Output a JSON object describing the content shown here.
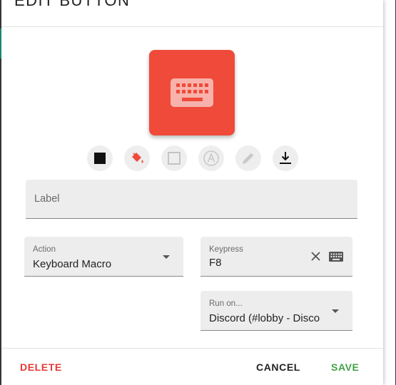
{
  "dialog": {
    "title": "EDIT BUTTON"
  },
  "preview": {
    "background_color": "#f04a3a",
    "icon": "keyboard-icon"
  },
  "toolbar": {
    "tools": [
      {
        "name": "color-swatch-icon",
        "state": "enabled"
      },
      {
        "name": "paint-bucket-icon",
        "state": "enabled"
      },
      {
        "name": "border-square-icon",
        "state": "disabled"
      },
      {
        "name": "text-a-icon",
        "state": "disabled"
      },
      {
        "name": "pencil-icon",
        "state": "disabled"
      },
      {
        "name": "download-icon",
        "state": "enabled"
      }
    ]
  },
  "label_field": {
    "placeholder": "Label",
    "value": ""
  },
  "action_field": {
    "label": "Action",
    "value": "Keyboard Macro"
  },
  "keypress_field": {
    "label": "Keypress",
    "value": "F8"
  },
  "run_on_field": {
    "label": "Run on...",
    "value": "Discord (#lobby - Disco"
  },
  "footer": {
    "delete_label": "DELETE",
    "cancel_label": "CANCEL",
    "save_label": "SAVE"
  },
  "colors": {
    "accent_red": "#f04a3a",
    "delete_red": "#e53935",
    "save_green": "#43a047"
  }
}
